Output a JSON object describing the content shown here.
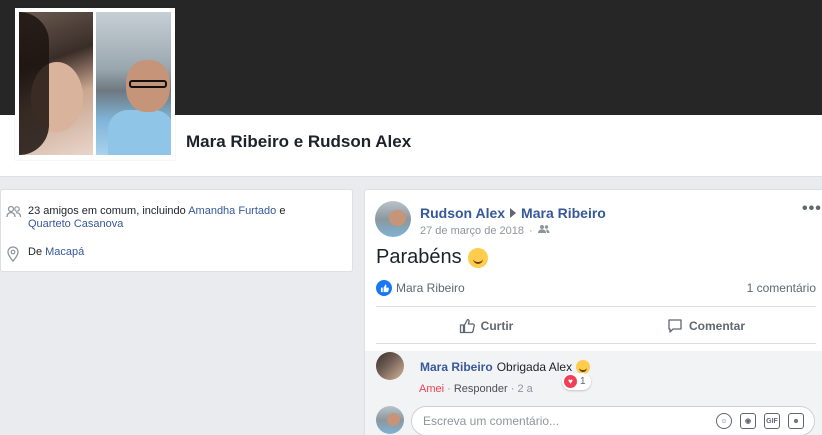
{
  "profile": {
    "title": "Mara Ribeiro e Rudson Alex"
  },
  "intro": {
    "mutual_prefix": "23 amigos em comum, incluindo",
    "mutual_friend_1": "Amandha Furtado",
    "mutual_and": "e",
    "mutual_friend_2": "Quarteto Casanova",
    "from_label": "De",
    "from_city": "Macapá",
    "icons": [
      "friends-icon",
      "location-pin-icon"
    ]
  },
  "post": {
    "author": "Rudson Alex",
    "recipient": "Mara Ribeiro",
    "date": "27 de março de 2018",
    "privacy_icon": "friends-icon",
    "message": "Parabéns",
    "more": "•••",
    "reactor": "Mara Ribeiro",
    "comment_count": "1 comentário",
    "like_label": "Curtir",
    "comment_label": "Comentar"
  },
  "comment": {
    "author": "Mara Ribeiro",
    "text": "Obrigada Alex",
    "love_action": "Amei",
    "reply_action": "Responder",
    "time": "2 a",
    "reaction_count": "1"
  },
  "composer": {
    "placeholder": "Escreva um comentário...",
    "icons": [
      "emoji-icon",
      "camera-icon",
      "gif-icon",
      "sticker-icon"
    ],
    "gif_text": "GIF"
  },
  "colors": {
    "link": "#365899",
    "like_blue": "#1877f2",
    "love_red": "#f33e58",
    "cover": "#262626"
  }
}
